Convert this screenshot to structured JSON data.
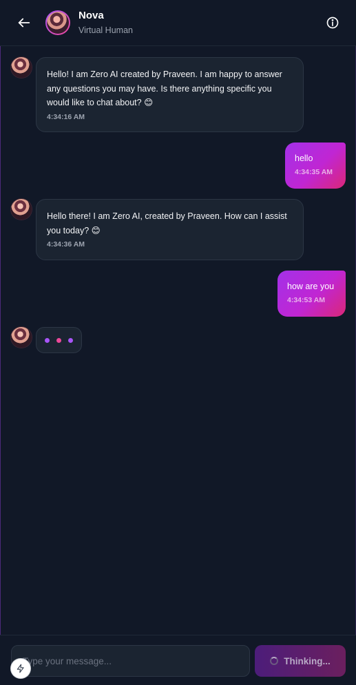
{
  "header": {
    "name": "Nova",
    "status": "Virtual Human",
    "back_icon": "arrow-left-icon",
    "info_icon": "info-icon"
  },
  "messages": [
    {
      "role": "bot",
      "text": "Hello! I am Zero AI created by Praveen. I am happy to answer any questions you may have. Is there anything specific you would like to chat about? 😊",
      "time": "4:34:16 AM"
    },
    {
      "role": "user",
      "text": "hello",
      "time": "4:34:35 AM"
    },
    {
      "role": "bot",
      "text": "Hello there! I am Zero AI, created by Praveen. How can I assist you today? 😊",
      "time": "4:34:36 AM"
    },
    {
      "role": "user",
      "text": "how are you",
      "time": "4:34:53 AM"
    }
  ],
  "typing": {
    "dot_colors": [
      "#a855f7",
      "#ec4899",
      "#a855f7"
    ]
  },
  "composer": {
    "placeholder": "Type your message...",
    "send_label": "Thinking...",
    "bolt_icon": "lightning-icon"
  },
  "colors": {
    "background": "#111827",
    "accent_start": "#a331e8",
    "accent_end": "#db2777",
    "bot_bubble": "#1b2431"
  }
}
